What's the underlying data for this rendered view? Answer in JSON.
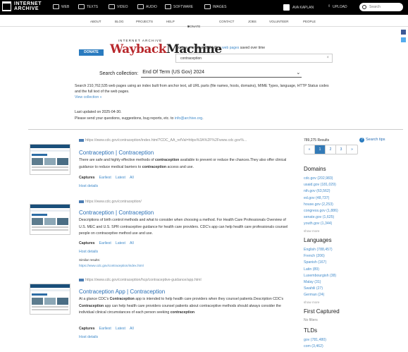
{
  "topbar": {
    "logo_line1": "INTERNET",
    "logo_line2": "ARCHIVE",
    "nav": [
      {
        "label": "WEB",
        "icon": "web-icon"
      },
      {
        "label": "TEXTS",
        "icon": "book-icon"
      },
      {
        "label": "VIDEO",
        "icon": "film-icon"
      },
      {
        "label": "AUDIO",
        "icon": "speaker-icon"
      },
      {
        "label": "SOFTWARE",
        "icon": "floppy-icon"
      },
      {
        "label": "IMAGES",
        "icon": "image-icon"
      }
    ],
    "user": "AVA KAPLAN",
    "upload": "UPLOAD",
    "search_placeholder": "Search"
  },
  "subnav": [
    "ABOUT",
    "BLOG",
    "PROJECTS",
    "HELP",
    "DONATE",
    "CONTACT",
    "JOBS",
    "VOLUNTEER",
    "PEOPLE"
  ],
  "wayback": {
    "donate": "DONATE",
    "logo_top": "INTERNET ARCHIVE",
    "logo_way": "Wayback",
    "logo_machine": "Machine",
    "explore_pre": "Explore more than 928 billion",
    "explore_link": "web pages",
    "explore_post": "saved over time",
    "query": "contraception"
  },
  "collection": {
    "label": "Search collection:",
    "value": "End Of Term (US Gov) 2024"
  },
  "description": {
    "text": "Search 210,762,535 web pages using an index built from anchor text, all URL parts (file names, hosts, domains), MIME Types, language, HTTP Status codes and the full text of the web pages.",
    "view_link": "View collection »",
    "updated": "Last updated on 2025-04-30.",
    "feedback_pre": "Please send your questions, suggestions, bug reports, etc. to",
    "feedback_email": "info@archive.org",
    "feedback_post": "."
  },
  "results": [
    {
      "url": "https://www.cdc.gov/contraception/index.html?CDC_AA_refVal=https%3A%2F%2Fwww.cdc.gov%...",
      "title": "Contraception | Contraception",
      "snippet": [
        {
          "t": "There are safe and highly effective methods of ",
          "b": false
        },
        {
          "t": "contraception",
          "b": true
        },
        {
          "t": " available to prevent or reduce the chances.They also offer clinical guidance to reduce medical barriers to ",
          "b": false
        },
        {
          "t": "contraception",
          "b": true
        },
        {
          "t": " access and use.",
          "b": false
        }
      ],
      "captures": "Captures",
      "earliest": "Earliest",
      "latest": "Latest",
      "all": "All",
      "host": "Host details"
    },
    {
      "url": "https://www.cdc.gov/contraception/",
      "title": "Contraception | Contraception",
      "snippet": [
        {
          "t": "Descriptions of birth control methods and what to consider when choosing a method. For Health Care Professionals Overview of U.S. MEC and U.S. SPR contraceptive guidance for health care providers. CDC's app can help health care professionals counsel people on contraceptive method use and use.",
          "b": false
        }
      ],
      "captures": "Captures",
      "earliest": "Earliest",
      "latest": "Latest",
      "all": "All",
      "host": "Host details",
      "similar_label": "Similar results:",
      "similar_url": "https://www.cdc.gov/contraception/index.html"
    },
    {
      "url": "https://www.cdc.gov/contraception/hcp/contraceptive-guidance/app.html",
      "title": "Contraception App | Contraception",
      "snippet": [
        {
          "t": "At a glance CDC's ",
          "b": false
        },
        {
          "t": "Contraception",
          "b": true
        },
        {
          "t": " app is intended to help health care providers when they counsel patients.Description CDC's ",
          "b": false
        },
        {
          "t": "Contraception",
          "b": true
        },
        {
          "t": " app can help health care providers counsel patients about contraceptive methods should always consider the individual clinical circumstances of each person seeking ",
          "b": false
        },
        {
          "t": "contraception",
          "b": true
        }
      ],
      "captures": "Captures",
      "earliest": "Earliest",
      "latest": "Latest",
      "all": "All",
      "host": "Host details"
    }
  ],
  "sidebar": {
    "count": "789,275 Results",
    "search_tips": "Search tips",
    "pager": [
      "«",
      "1",
      "2",
      "3",
      "»"
    ],
    "domains_title": "Domains",
    "domains": [
      "cdc.gov (202,983)",
      "usaid.gov (181,029)",
      "nih.gov (63,562)",
      "ed.gov (48,737)",
      "house.gov (2,253)",
      "congress.gov (1,886)",
      "senate.gov (1,625)",
      "youth.gov (1,344)"
    ],
    "show_more": "show more",
    "languages_title": "Languages",
    "languages": [
      "English (788,457)",
      "French (206)",
      "Spanish (167)",
      "Latin (89)",
      "Luxembourgish (38)",
      "Malay (31)",
      "Swahili (27)",
      "German (24)"
    ],
    "first_captured_title": "First Captured",
    "no_filters": "No filters",
    "tlds_title": "TLDs",
    "tlds": [
      "gov (781,480)",
      "com (3,462)"
    ]
  },
  "colors": {
    "topbar": "#000000",
    "link": "#2a6fb5",
    "wayback_red": "#b8282c",
    "donate": "#2a7bbf"
  }
}
